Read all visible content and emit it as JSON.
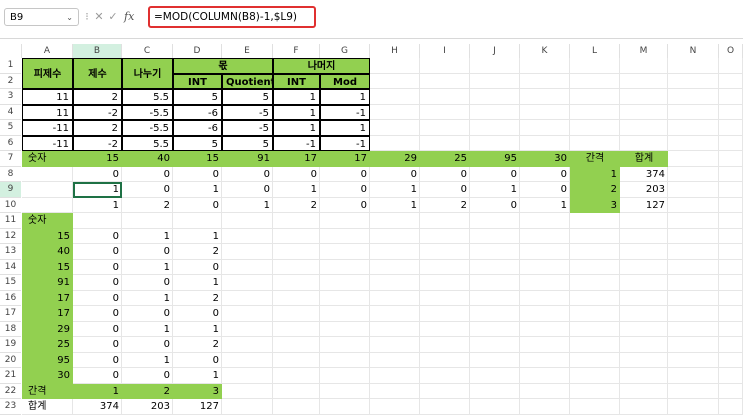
{
  "formula_bar": {
    "name_box": "B9",
    "cancel": "✕",
    "enter": "✓",
    "fx": "fx",
    "formula": "=MOD(COLUMN(B8)-1,$L9)"
  },
  "columns": [
    "A",
    "B",
    "C",
    "D",
    "E",
    "F",
    "G",
    "H",
    "I",
    "J",
    "K",
    "L",
    "M",
    "N",
    "O"
  ],
  "rows": [
    "1",
    "2",
    "3",
    "4",
    "5",
    "6",
    "7",
    "8",
    "9",
    "10",
    "11",
    "12",
    "13",
    "14",
    "15",
    "16",
    "17",
    "18",
    "19",
    "20",
    "21",
    "22",
    "23"
  ],
  "headers": {
    "a12": "피제수",
    "b12": "제수",
    "c12": "나누기",
    "de1": "몫",
    "fg1": "나머지",
    "d2": "INT",
    "e2": "Quotient",
    "f2": "INT",
    "g2": "Mod"
  },
  "table1": [
    [
      "11",
      "2",
      "5.5",
      "5",
      "5",
      "1",
      "1"
    ],
    [
      "11",
      "-2",
      "-5.5",
      "-6",
      "-5",
      "1",
      "-1"
    ],
    [
      "-11",
      "2",
      "-5.5",
      "-6",
      "-5",
      "1",
      "1"
    ],
    [
      "-11",
      "-2",
      "5.5",
      "5",
      "5",
      "-1",
      "-1"
    ]
  ],
  "row7": {
    "a": "숫자",
    "nums": [
      "15",
      "40",
      "15",
      "91",
      "17",
      "17",
      "29",
      "25",
      "95",
      "30"
    ],
    "l": "간격",
    "m": "합계"
  },
  "rows8_10": [
    {
      "vals": [
        "0",
        "0",
        "0",
        "0",
        "0",
        "0",
        "0",
        "0",
        "0",
        "0"
      ],
      "l": "1",
      "m": "374"
    },
    {
      "vals": [
        "1",
        "0",
        "1",
        "0",
        "1",
        "0",
        "1",
        "0",
        "1",
        "0"
      ],
      "l": "2",
      "m": "203"
    },
    {
      "vals": [
        "1",
        "2",
        "0",
        "1",
        "2",
        "0",
        "1",
        "2",
        "0",
        "1"
      ],
      "l": "3",
      "m": "127"
    }
  ],
  "row11": "숫자",
  "vertical": [
    {
      "a": "15",
      "b": "0",
      "c": "1",
      "d": "1"
    },
    {
      "a": "40",
      "b": "0",
      "c": "0",
      "d": "2"
    },
    {
      "a": "15",
      "b": "0",
      "c": "1",
      "d": "0"
    },
    {
      "a": "91",
      "b": "0",
      "c": "0",
      "d": "1"
    },
    {
      "a": "17",
      "b": "0",
      "c": "1",
      "d": "2"
    },
    {
      "a": "17",
      "b": "0",
      "c": "0",
      "d": "0"
    },
    {
      "a": "29",
      "b": "0",
      "c": "1",
      "d": "1"
    },
    {
      "a": "25",
      "b": "0",
      "c": "0",
      "d": "2"
    },
    {
      "a": "95",
      "b": "0",
      "c": "1",
      "d": "0"
    },
    {
      "a": "30",
      "b": "0",
      "c": "0",
      "d": "1"
    }
  ],
  "row22": {
    "a": "간격",
    "b": "1",
    "c": "2",
    "d": "3"
  },
  "row23": {
    "a": "합계",
    "b": "374",
    "c": "203",
    "d": "127"
  },
  "colors": {
    "header_fill": "#92d050",
    "selection": "#1e7145",
    "formula_highlight": "#e03030"
  }
}
